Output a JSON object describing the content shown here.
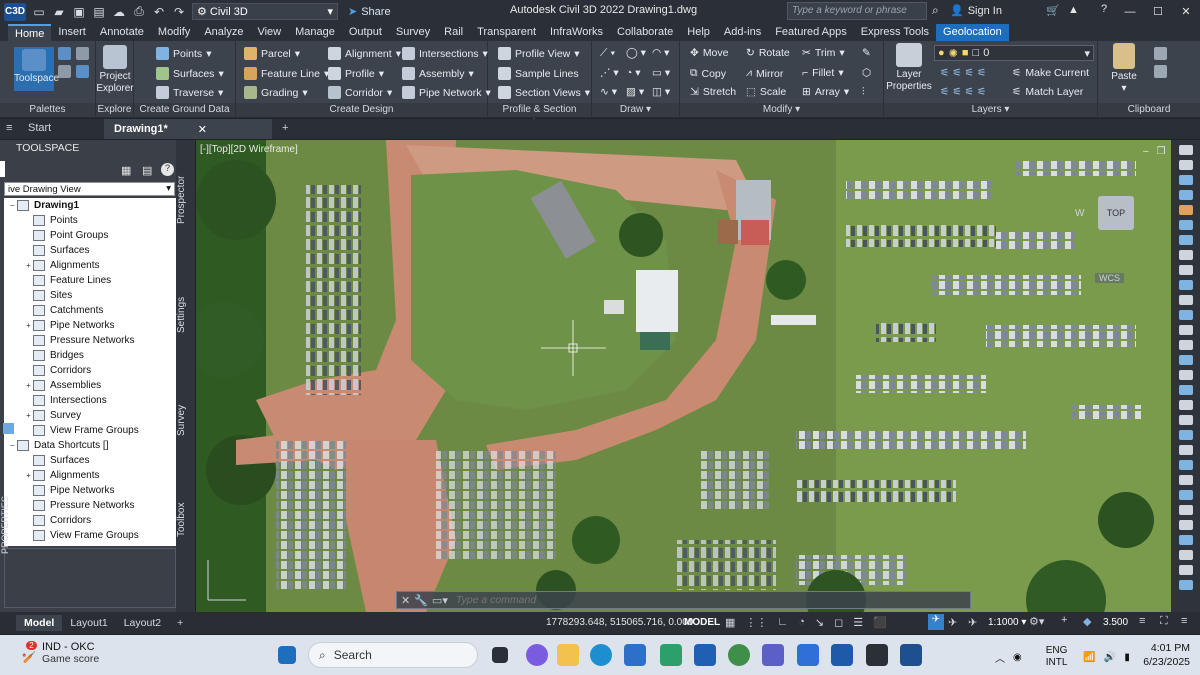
{
  "title_bar": {
    "logo_text": "C3D",
    "workspace": "Civil 3D",
    "share": "Share",
    "title": "Autodesk Civil 3D 2022    Drawing1.dwg",
    "search_placeholder": "Type a keyword or phrase",
    "signin": "Sign In"
  },
  "ribbon_tabs": [
    "Home",
    "Insert",
    "Annotate",
    "Modify",
    "Analyze",
    "View",
    "Manage",
    "Output",
    "Survey",
    "Rail",
    "Transparent",
    "InfraWorks",
    "Collaborate",
    "Help",
    "Add-ins",
    "Featured Apps",
    "Express Tools",
    "Geolocation"
  ],
  "ribbon": {
    "palettes": {
      "toolspace": "Toolspace",
      "title": "Palettes"
    },
    "explore": {
      "button": "Project Explorer",
      "title": "Explore"
    },
    "ground": {
      "points": "Points",
      "surfaces": "Surfaces",
      "traverse": "Traverse",
      "title": "Create Ground Data"
    },
    "design": {
      "parcel": "Parcel",
      "feature_line": "Feature Line",
      "grading": "Grading",
      "alignment": "Alignment",
      "profile": "Profile",
      "corridor": "Corridor",
      "intersections": "Intersections",
      "assembly": "Assembly",
      "pipe_network": "Pipe Network",
      "title": "Create Design"
    },
    "profile_section": {
      "profile_view": "Profile View",
      "sample_lines": "Sample Lines",
      "section_views": "Section Views",
      "title": "Profile & Section Views"
    },
    "draw": {
      "title": "Draw"
    },
    "modify": {
      "move": "Move",
      "rotate": "Rotate",
      "trim": "Trim",
      "copy": "Copy",
      "mirror": "Mirror",
      "fillet": "Fillet",
      "stretch": "Stretch",
      "scale": "Scale",
      "array": "Array",
      "title": "Modify"
    },
    "layers": {
      "layer_properties": "Layer Properties",
      "current_layer": "0",
      "make_current": "Make Current",
      "match_layer": "Match Layer",
      "title": "Layers"
    },
    "clipboard": {
      "paste": "Paste",
      "title": "Clipboard"
    }
  },
  "doc_tabs": {
    "start": "Start",
    "active": "Drawing1*"
  },
  "toolspace": {
    "header": "TOOLSPACE",
    "view": "ive Drawing View",
    "side_tabs": [
      "Prospector",
      "Settings",
      "Survey",
      "Toolbox"
    ],
    "properties_tab": "PROPERTIES",
    "tree": [
      {
        "label": "Drawing1",
        "level": 0,
        "bold": true,
        "expander": "−"
      },
      {
        "label": "Points",
        "level": 1,
        "expander": ""
      },
      {
        "label": "Point Groups",
        "level": 1,
        "expander": ""
      },
      {
        "label": "Surfaces",
        "level": 1,
        "expander": ""
      },
      {
        "label": "Alignments",
        "level": 1,
        "expander": "+"
      },
      {
        "label": "Feature Lines",
        "level": 1,
        "expander": ""
      },
      {
        "label": "Sites",
        "level": 1,
        "expander": ""
      },
      {
        "label": "Catchments",
        "level": 1,
        "expander": ""
      },
      {
        "label": "Pipe Networks",
        "level": 1,
        "expander": "+"
      },
      {
        "label": "Pressure Networks",
        "level": 1,
        "expander": ""
      },
      {
        "label": "Bridges",
        "level": 1,
        "expander": ""
      },
      {
        "label": "Corridors",
        "level": 1,
        "expander": ""
      },
      {
        "label": "Assemblies",
        "level": 1,
        "expander": "+"
      },
      {
        "label": "Intersections",
        "level": 1,
        "expander": ""
      },
      {
        "label": "Survey",
        "level": 1,
        "expander": "+"
      },
      {
        "label": "View Frame Groups",
        "level": 1,
        "expander": ""
      },
      {
        "label": "Data Shortcuts []",
        "level": 0,
        "expander": "−"
      },
      {
        "label": "Surfaces",
        "level": 1,
        "expander": ""
      },
      {
        "label": "Alignments",
        "level": 1,
        "expander": "+"
      },
      {
        "label": "Pipe Networks",
        "level": 1,
        "expander": ""
      },
      {
        "label": "Pressure Networks",
        "level": 1,
        "expander": ""
      },
      {
        "label": "Corridors",
        "level": 1,
        "expander": ""
      },
      {
        "label": "View Frame Groups",
        "level": 1,
        "expander": ""
      }
    ]
  },
  "viewport": {
    "label": "[-][Top][2D Wireframe]",
    "viewcube": "TOP",
    "viewcube_w": "W",
    "wcs": "WCS",
    "command_placeholder": "Type a command"
  },
  "status_bar": {
    "layout_tabs": [
      "Model",
      "Layout1",
      "Layout2"
    ],
    "coordinates": "1778293.648, 515065.716, 0.000",
    "model": "MODEL",
    "scale": "1:1000",
    "annotation_value": "3.500"
  },
  "taskbar": {
    "notification_badge": "2",
    "game_title": "IND - OKC",
    "game_subtitle": "Game score",
    "search": "Search",
    "lang_1": "ENG",
    "lang_2": "INTL",
    "time": "4:01 PM",
    "date": "6/23/2025"
  },
  "colors": {
    "accent": "#1d6fbd",
    "ribbon_bg": "#3d434d",
    "grass": "#5b7a3a",
    "dirt": "#c98a72"
  }
}
